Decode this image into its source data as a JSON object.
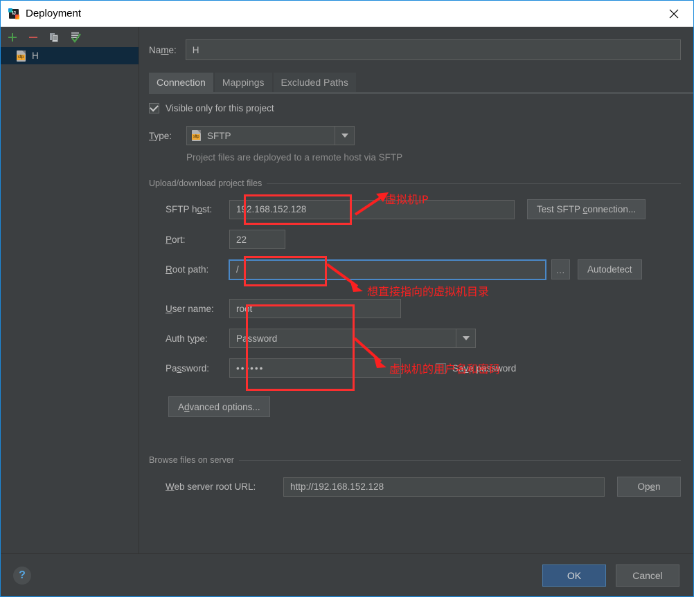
{
  "window": {
    "title": "Deployment",
    "app_icon": "intellij-idea-icon",
    "close_icon": "close-icon",
    "accent_blue": "#1c8adb",
    "background": "#3c3f41"
  },
  "sidebar": {
    "toolbar": [
      {
        "name": "add-button",
        "icon": "plus-icon",
        "color": "#4b9b4b"
      },
      {
        "name": "remove-button",
        "icon": "minus-icon",
        "color": "#c75450"
      },
      {
        "name": "copy-button",
        "icon": "copy-icon",
        "color": "#9aa0a6"
      },
      {
        "name": "set-default-button",
        "icon": "list-check-icon",
        "color": "#4b9b4b"
      }
    ],
    "items": [
      {
        "label": "H",
        "icon": "sftp-file-icon",
        "icon_tag": "sftp",
        "selected": true
      }
    ]
  },
  "form": {
    "name_label": "Name:",
    "name_value": "H",
    "tabs": [
      {
        "label": "Connection",
        "active": true
      },
      {
        "label": "Mappings",
        "active": false
      },
      {
        "label": "Excluded Paths",
        "active": false
      }
    ],
    "visible_only_checkbox": {
      "label": "Visible only for this project",
      "checked": true
    },
    "type_label": "Type:",
    "type_value": "SFTP",
    "type_icon_tag": "sftp",
    "type_hint": "Project files are deployed to a remote host via SFTP",
    "upload_group_title": "Upload/download project files",
    "sftp_host_label": "SFTP host:",
    "sftp_host_value": "192.168.152.128",
    "test_connection_button": "Test SFTP connection...",
    "port_label": "Port:",
    "port_value": "22",
    "root_path_label": "Root path:",
    "root_path_value": "/",
    "browse_button": "...",
    "autodetect_button": "Autodetect",
    "user_name_label": "User name:",
    "user_name_value": "root",
    "auth_type_label": "Auth type:",
    "auth_type_value": "Password",
    "password_label": "Password:",
    "password_value": "••••••",
    "save_password_checkbox": {
      "label": "Save password",
      "checked": false
    },
    "advanced_options_button": "Advanced options...",
    "browse_group_title": "Browse files on server",
    "web_server_url_label": "Web server root URL:",
    "web_server_url_value": "http://192.168.152.128",
    "open_button": "Open"
  },
  "annotations": {
    "color": "#fb2020",
    "notes": [
      {
        "name": "annotation-vm-ip",
        "text": "虚拟机IP"
      },
      {
        "name": "annotation-vm-directory",
        "text": "想直接指向的虚拟机目录"
      },
      {
        "name": "annotation-vm-credentials",
        "text": "虚拟机的用户名和密码"
      }
    ]
  },
  "footer": {
    "help_label": "?",
    "ok_label": "OK",
    "cancel_label": "Cancel"
  }
}
